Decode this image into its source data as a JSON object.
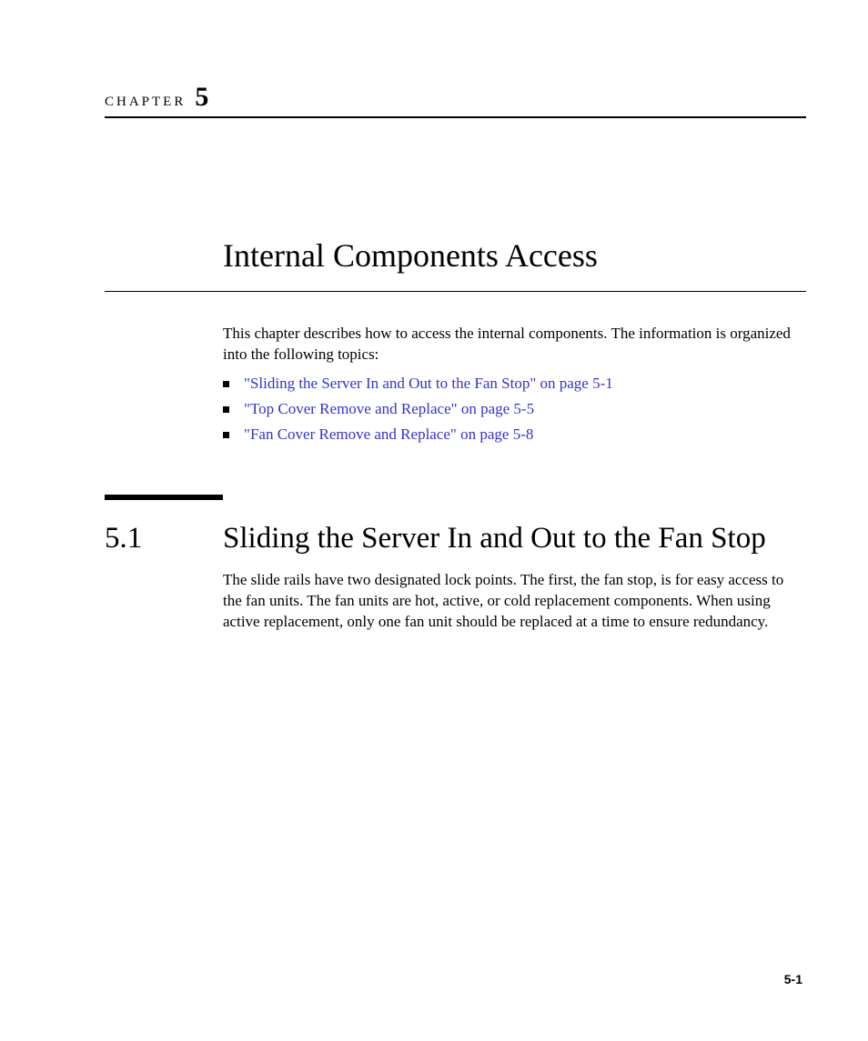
{
  "chapter": {
    "label": "CHAPTER",
    "number": "5",
    "title": "Internal Components Access"
  },
  "intro": "This chapter describes how to access the internal components. The information is organized into the following topics:",
  "toc": [
    "\"Sliding the Server In and Out to the Fan Stop\" on page 5-1",
    "\"Top Cover Remove and Replace\" on page 5-5",
    "\"Fan Cover Remove and Replace\" on page 5-8"
  ],
  "section": {
    "number": "5.1",
    "title": "Sliding the Server In and Out to the Fan Stop",
    "body": "The slide rails have two designated lock points. The first, the fan stop, is for easy access to the fan units. The fan units are hot, active, or cold replacement components. When using active replacement, only one fan unit should be replaced at a time to ensure redundancy."
  },
  "page_number": "5-1"
}
